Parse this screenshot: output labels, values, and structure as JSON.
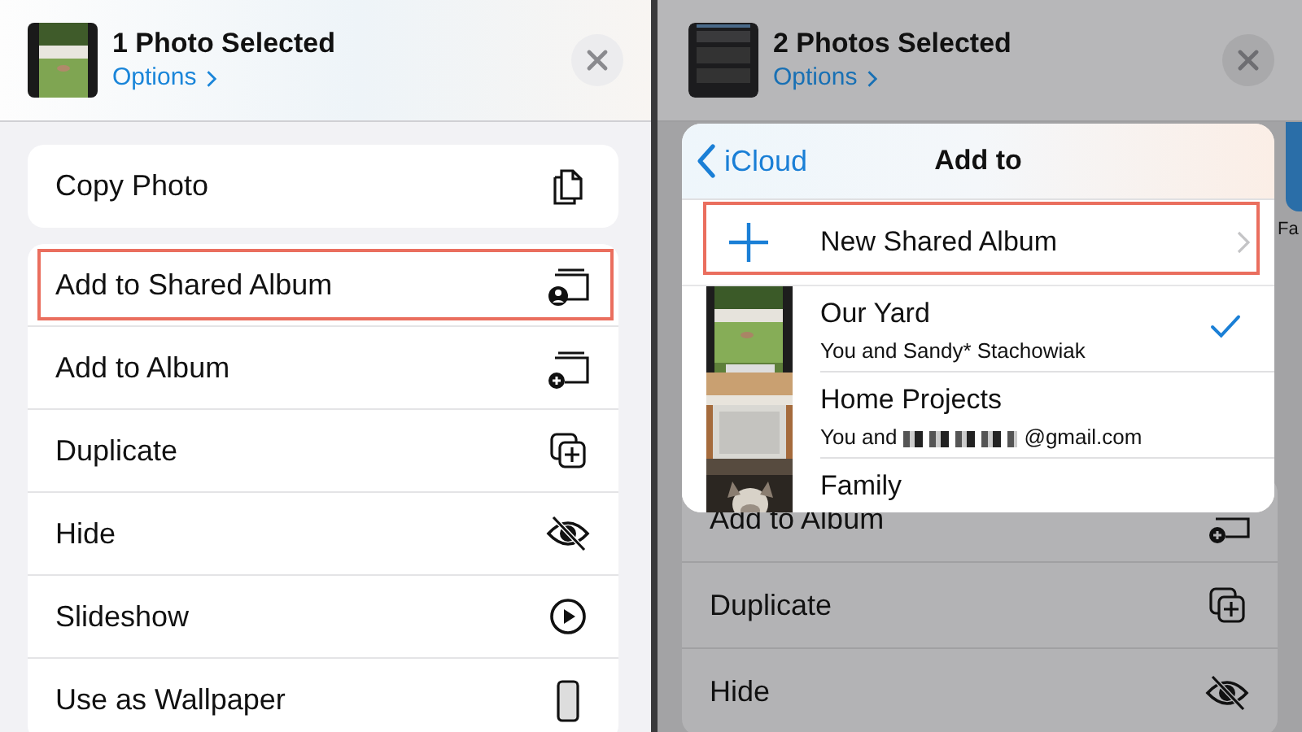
{
  "left": {
    "header": {
      "title": "1 Photo Selected",
      "options": "Options"
    },
    "groups": [
      [
        {
          "label": "Copy Photo",
          "highlighted": false
        }
      ],
      [
        {
          "label": "Add to Shared Album",
          "highlighted": true
        },
        {
          "label": "Add to Album",
          "highlighted": false
        },
        {
          "label": "Duplicate",
          "highlighted": false
        },
        {
          "label": "Hide",
          "highlighted": false
        },
        {
          "label": "Slideshow",
          "highlighted": false
        },
        {
          "label": "Use as Wallpaper",
          "highlighted": false
        }
      ]
    ]
  },
  "right": {
    "header": {
      "title": "2 Photos Selected",
      "options": "Options"
    },
    "side_label": "Fa",
    "rows": [
      {
        "label": "Add to Album"
      },
      {
        "label": "Duplicate"
      },
      {
        "label": "Hide"
      }
    ],
    "popup": {
      "back": "iCloud",
      "title": "Add to",
      "new_album": {
        "label": "New Shared Album",
        "highlighted": true
      },
      "albums": [
        {
          "name": "Our Yard",
          "subtitle": "You and Sandy* Stachowiak",
          "selected": true
        },
        {
          "name": "Home Projects",
          "subtitle": "You and",
          "subtitle_end": "@gmail.com",
          "redacted": true,
          "selected": false
        },
        {
          "name": "Family",
          "selected": false
        }
      ]
    }
  }
}
